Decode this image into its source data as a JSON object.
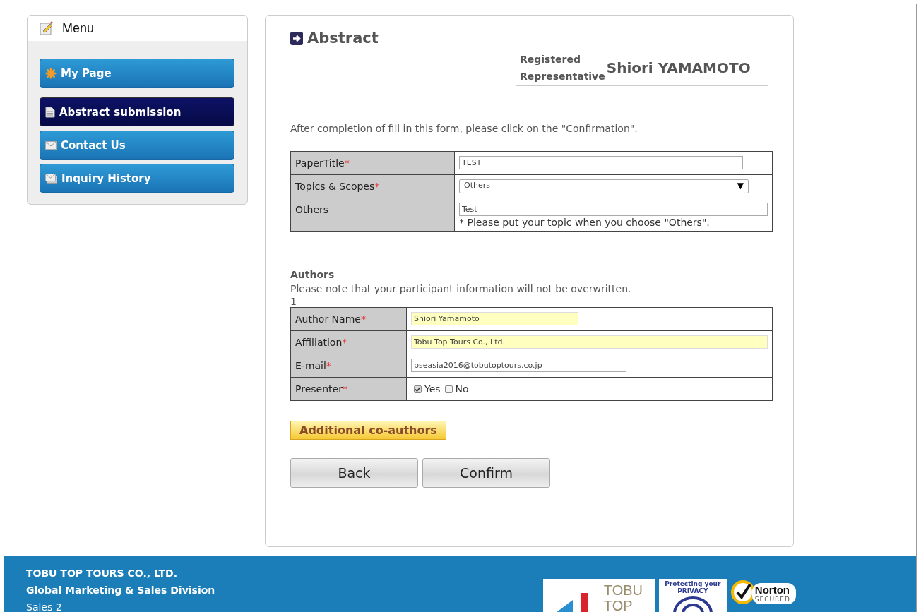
{
  "menu": {
    "title": "Menu",
    "items": [
      {
        "label": "My Page",
        "kind": "star",
        "selected": false
      },
      {
        "label": "Abstract submission",
        "kind": "document",
        "selected": true
      },
      {
        "label": "Contact Us",
        "kind": "mail",
        "selected": false
      },
      {
        "label": "Inquiry History",
        "kind": "mails",
        "selected": false
      }
    ]
  },
  "page": {
    "title": "Abstract",
    "representative_label": [
      "Registered",
      "Representative"
    ],
    "representative_name": "Shiori YAMAMOTO",
    "instruction": "After completion of fill in this form, please click on the \"Confirmation\"."
  },
  "paper_form": [
    {
      "label": "PaperTitle",
      "required_mark": "*",
      "kind": "text",
      "value": "TEST",
      "highlighted": false,
      "wide": false
    },
    {
      "label": "Topics & Scopes",
      "required_mark": "*",
      "kind": "select",
      "value": "Others",
      "arrow": "▼"
    },
    {
      "label": "Others",
      "kind": "text",
      "value": "Test",
      "highlighted": false,
      "wide": true,
      "note": "* Please put your topic when you choose \"Others\"."
    }
  ],
  "authors": {
    "heading": "Authors",
    "note": "Please note that your participant information will not be overwritten.",
    "number": "1",
    "rows": [
      {
        "label": "Author Name",
        "required_mark": "*",
        "kind": "text",
        "value": "Shiori Yamamoto",
        "highlighted": true,
        "wide": false
      },
      {
        "label": "Affiliation",
        "required_mark": "*",
        "kind": "text",
        "value": "Tobu Top Tours Co., Ltd.",
        "highlighted": true,
        "wide": true
      },
      {
        "label": "E-mail",
        "required_mark": "*",
        "kind": "text",
        "value": "pseasia2016@tobutoptours.co.jp",
        "highlighted": false,
        "wide": false
      },
      {
        "label": "Presenter",
        "required_mark": "*",
        "kind": "checks",
        "options": [
          {
            "label": "Yes",
            "checked": true
          },
          {
            "label": "No",
            "checked": false
          }
        ]
      }
    ]
  },
  "add_button": "Additional co-authors",
  "buttons": [
    "Back",
    "Confirm"
  ],
  "footer": {
    "lines": [
      {
        "text": "TOBU TOP TOURS CO., LTD.",
        "bold": true
      },
      {
        "text": "Global Marketing & Sales Division",
        "bold": true
      },
      {
        "text": "Sales 2",
        "bold": false
      }
    ],
    "logos": [
      {
        "kind": "tobu",
        "text": [
          "TOBU",
          "TOP"
        ]
      },
      {
        "kind": "privacy",
        "text": [
          "Protecting your PRIVACY"
        ]
      },
      {
        "kind": "norton",
        "text": [
          "Norton",
          "SECURED"
        ]
      }
    ]
  }
}
